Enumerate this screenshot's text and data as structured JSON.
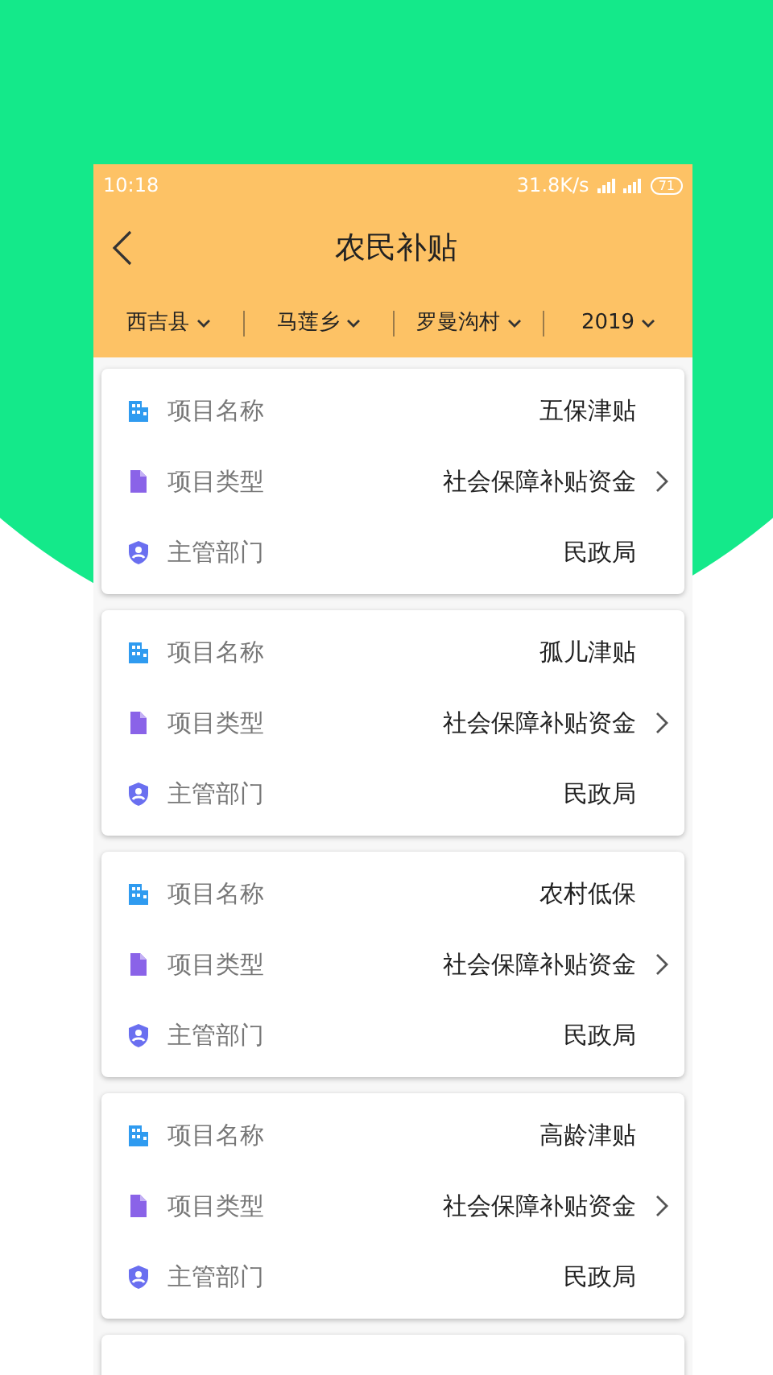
{
  "status_bar": {
    "time": "10:18",
    "speed": "31.8K/s",
    "battery": "71"
  },
  "header": {
    "title": "农民补贴"
  },
  "filters": [
    {
      "label": "西吉县"
    },
    {
      "label": "马莲乡"
    },
    {
      "label": "罗曼沟村"
    },
    {
      "label": "2019"
    }
  ],
  "cards": [
    {
      "rows": [
        {
          "kind": "name",
          "label": "项目名称",
          "value": "五保津贴"
        },
        {
          "kind": "type",
          "label": "项目类型",
          "value": "社会保障补贴资金"
        },
        {
          "kind": "dept",
          "label": "主管部门",
          "value": "民政局"
        }
      ]
    },
    {
      "rows": [
        {
          "kind": "name",
          "label": "项目名称",
          "value": "孤儿津贴"
        },
        {
          "kind": "type",
          "label": "项目类型",
          "value": "社会保障补贴资金"
        },
        {
          "kind": "dept",
          "label": "主管部门",
          "value": "民政局"
        }
      ]
    },
    {
      "rows": [
        {
          "kind": "name",
          "label": "项目名称",
          "value": "农村低保"
        },
        {
          "kind": "type",
          "label": "项目类型",
          "value": "社会保障补贴资金"
        },
        {
          "kind": "dept",
          "label": "主管部门",
          "value": "民政局"
        }
      ]
    },
    {
      "rows": [
        {
          "kind": "name",
          "label": "项目名称",
          "value": "高龄津贴"
        },
        {
          "kind": "type",
          "label": "项目类型",
          "value": "社会保障补贴资金"
        },
        {
          "kind": "dept",
          "label": "主管部门",
          "value": "民政局"
        }
      ]
    }
  ]
}
